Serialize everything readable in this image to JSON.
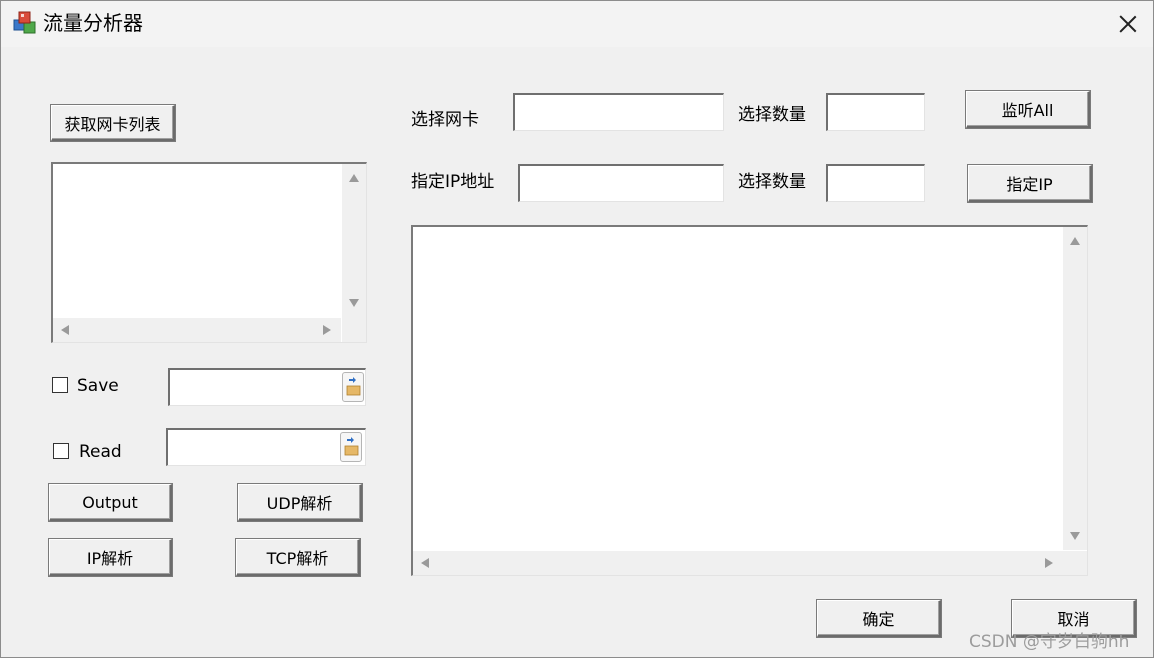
{
  "window": {
    "title": "流量分析器",
    "icon": "packages-app-icon",
    "close_icon": "close-icon"
  },
  "left": {
    "get_nic_button": "获取网卡列表",
    "save_label": "Save",
    "read_label": "Read",
    "save_checked": false,
    "read_checked": false,
    "save_path": "",
    "read_path": "",
    "browse_icon": "folder-browse-icon",
    "buttons": {
      "output": "Output",
      "udp": "UDP解析",
      "ip": "IP解析",
      "tcp": "TCP解析"
    }
  },
  "right": {
    "select_nic_label": "选择网卡",
    "select_nic_value": "",
    "select_count_label_1": "选择数量",
    "select_count_value_1": "",
    "listen_all_button": "监听All",
    "ip_label": "指定IP地址",
    "ip_value": "",
    "select_count_label_2": "选择数量",
    "select_count_value_2": "",
    "specify_ip_button": "指定IP"
  },
  "footer": {
    "ok_button": "确定",
    "cancel_button": "取消",
    "watermark": "CSDN @守岁白驹hh"
  },
  "colors": {
    "background": "#f0f0f0",
    "field_background": "#ffffff",
    "border_dark": "#6b6b6b"
  }
}
